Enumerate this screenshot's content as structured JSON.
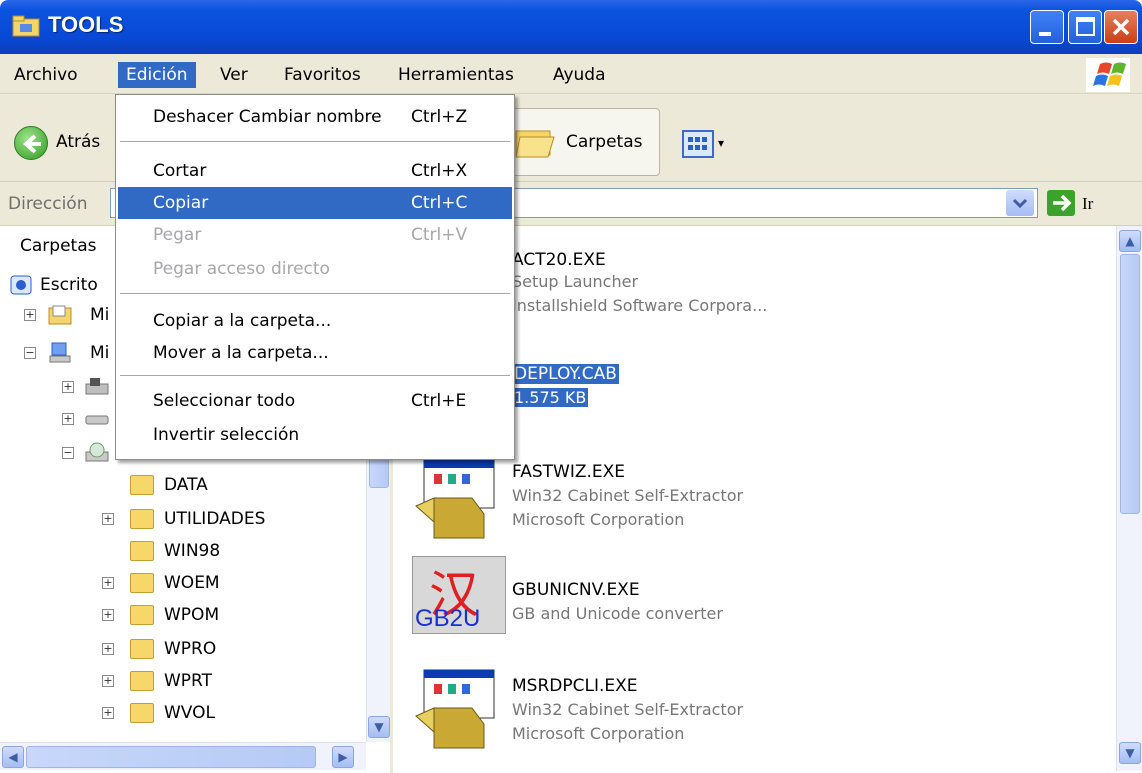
{
  "window": {
    "title": "TOOLS",
    "colors": {
      "titlebar": "#0a52df",
      "menu_highlight": "#316ac5",
      "chrome": "#ece9d8"
    }
  },
  "menubar": {
    "items": [
      "Archivo",
      "Edición",
      "Ver",
      "Favoritos",
      "Herramientas",
      "Ayuda"
    ],
    "active": "Edición"
  },
  "toolbar": {
    "back_label": "Atrás",
    "folders_label": "Carpetas"
  },
  "addressbar": {
    "label": "Dirección",
    "value": "",
    "go_label": "Ir"
  },
  "edit_menu": {
    "items": [
      {
        "label": "Deshacer Cambiar nombre",
        "shortcut": "Ctrl+Z",
        "state": "normal"
      },
      {
        "label": "Cortar",
        "shortcut": "Ctrl+X",
        "state": "normal"
      },
      {
        "label": "Copiar",
        "shortcut": "Ctrl+C",
        "state": "highlighted"
      },
      {
        "label": "Pegar",
        "shortcut": "Ctrl+V",
        "state": "disabled"
      },
      {
        "label": "Pegar acceso directo",
        "shortcut": "",
        "state": "disabled"
      },
      {
        "label": "Copiar a la carpeta...",
        "shortcut": "",
        "state": "normal"
      },
      {
        "label": "Mover a la carpeta...",
        "shortcut": "",
        "state": "normal"
      },
      {
        "label": "Seleccionar todo",
        "shortcut": "Ctrl+E",
        "state": "normal"
      },
      {
        "label": "Invertir selección",
        "shortcut": "",
        "state": "normal"
      }
    ]
  },
  "folders_pane": {
    "header": "Carpetas",
    "close_glyph": "×",
    "tree": [
      {
        "label": "Escritorio",
        "visible": "Escrito",
        "icon": "desktop-icon"
      },
      {
        "label": "Mis documentos",
        "visible": "Mi",
        "icon": "my-documents-icon"
      },
      {
        "label": "Mi PC",
        "visible": "Mi",
        "icon": "my-computer-icon"
      },
      {
        "label": "",
        "icon": "floppy-drive-icon"
      },
      {
        "label": "",
        "icon": "hard-drive-icon"
      },
      {
        "label": "",
        "icon": "cd-drive-icon"
      },
      {
        "label": "DATA",
        "icon": "folder-icon"
      },
      {
        "label": "UTILIDADES",
        "icon": "folder-icon"
      },
      {
        "label": "WIN98",
        "icon": "folder-icon"
      },
      {
        "label": "WOEM",
        "icon": "folder-icon"
      },
      {
        "label": "WPOM",
        "icon": "folder-icon"
      },
      {
        "label": "WPRO",
        "icon": "folder-icon"
      },
      {
        "label": "WPRT",
        "icon": "folder-icon"
      },
      {
        "label": "WVOL",
        "icon": "folder-icon"
      }
    ]
  },
  "files": [
    {
      "name": "ACT20.EXE",
      "line2": "Setup Launcher",
      "line3": "Installshield Software Corpora...",
      "selected": false
    },
    {
      "name": "DEPLOY.CAB",
      "line2": "1.575 KB",
      "line3": "",
      "selected": true
    },
    {
      "name": "FASTWIZ.EXE",
      "line2": "Win32 Cabinet Self-Extractor",
      "line3": "Microsoft Corporation",
      "selected": false
    },
    {
      "name": "GBUNICNV.EXE",
      "line2": "GB and Unicode converter",
      "line3": "",
      "selected": false
    },
    {
      "name": "MSRDPCLI.EXE",
      "line2": "Win32 Cabinet Self-Extractor",
      "line3": "Microsoft Corporation",
      "selected": false
    }
  ],
  "icons": {
    "gb2u_glyph": "汉",
    "gb2u_text": "GB2U"
  }
}
